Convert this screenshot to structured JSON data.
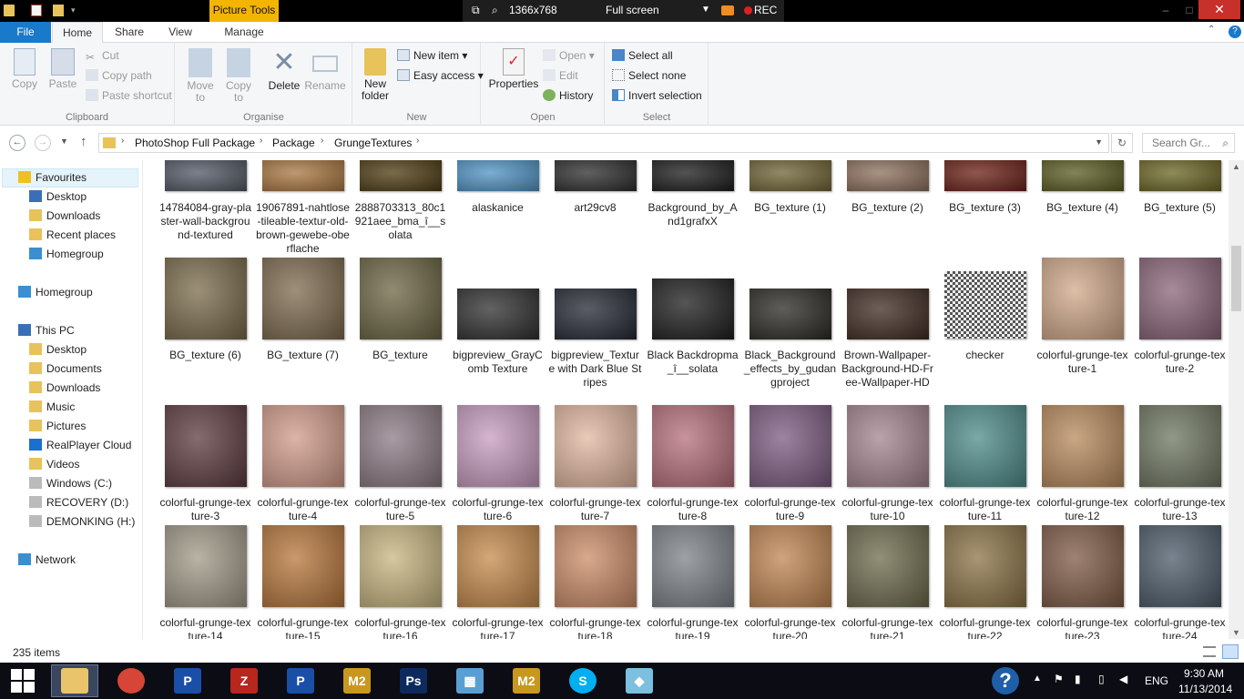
{
  "recorder": {
    "size_label": "1366x768",
    "mode_label": "Full screen",
    "rec_label": "REC"
  },
  "contextual_tab": "Picture Tools",
  "tabs": {
    "file": "File",
    "home": "Home",
    "share": "Share",
    "view": "View",
    "manage": "Manage"
  },
  "ribbon": {
    "clipboard": {
      "copy": "Copy",
      "paste": "Paste",
      "cut": "Cut",
      "copy_path": "Copy path",
      "paste_shortcut": "Paste shortcut",
      "label": "Clipboard"
    },
    "organise": {
      "move_to": "Move to",
      "copy_to": "Copy to",
      "delete": "Delete",
      "rename": "Rename",
      "label": "Organise"
    },
    "new": {
      "new_folder": "New folder",
      "new_item": "New item",
      "easy_access": "Easy access",
      "label": "New"
    },
    "open": {
      "properties": "Properties",
      "open": "Open",
      "edit": "Edit",
      "history": "History",
      "label": "Open"
    },
    "select": {
      "select_all": "Select all",
      "select_none": "Select none",
      "invert_selection": "Invert selection",
      "label": "Select"
    }
  },
  "breadcrumb": [
    "PhotoShop Full Package",
    "Package",
    "GrungeTextures"
  ],
  "search": {
    "placeholder": "Search Gr..."
  },
  "nav": {
    "favourites": "Favourites",
    "fav_items": [
      "Desktop",
      "Downloads",
      "Recent places",
      "Homegroup"
    ],
    "homegroup": "Homegroup",
    "this_pc": "This PC",
    "pc_items": [
      "Desktop",
      "Documents",
      "Downloads",
      "Music",
      "Pictures",
      "RealPlayer Cloud",
      "Videos",
      "Windows (C:)",
      "RECOVERY (D:)",
      "DEMONKING (H:)"
    ],
    "network": "Network"
  },
  "files": [
    {
      "name": "14784084-gray-plaster-wall-background-textured",
      "color": "#4f5663"
    },
    {
      "name": "19067891-nahtlose-tileable-textur-old-brown-gewebe-oberflache",
      "color": "#a9763f"
    },
    {
      "name": "2888703313_80c1921aee_bma_î__solata",
      "color": "#4c3a10"
    },
    {
      "name": "alaskanice",
      "color": "#4e93c4"
    },
    {
      "name": "art29cv8",
      "color": "#2b2b2b"
    },
    {
      "name": "Background_by_And1grafxX",
      "color": "#1a1a1a"
    },
    {
      "name": "BG_texture (1)",
      "color": "#6e6232"
    },
    {
      "name": "BG_texture (2)",
      "color": "#8c6f5c"
    },
    {
      "name": "BG_texture (3)",
      "color": "#6a1e14"
    },
    {
      "name": "BG_texture (4)",
      "color": "#5a5a20"
    },
    {
      "name": "BG_texture (5)",
      "color": "#6b6422"
    },
    {
      "name": "BG_texture (6)",
      "color": "#7a6b4a"
    },
    {
      "name": "BG_texture (7)",
      "color": "#7d6a4d"
    },
    {
      "name": "BG_texture",
      "color": "#6b6441"
    },
    {
      "name": "bigpreview_GrayComb Texture",
      "color": "#2e2e2e"
    },
    {
      "name": "bigpreview_Texture with Dark Blue Stripes",
      "color": "#232733"
    },
    {
      "name": "Black Backdropma_î__solata",
      "color": "#1c1c1c"
    },
    {
      "name": "Black_Background_effects_by_gudangproject",
      "color": "#2a2822"
    },
    {
      "name": "Brown-Wallpaper-Background-HD-Free-Wallpaper-HD",
      "color": "#3e2a20"
    },
    {
      "name": "checker",
      "color": "#9a9a9a"
    },
    {
      "name": "colorful-grunge-texture-1",
      "color": "#d2a98a"
    },
    {
      "name": "colorful-grunge-texture-2",
      "color": "#8a6478"
    },
    {
      "name": "colorful-grunge-texture-3",
      "color": "#5c3a3e"
    },
    {
      "name": "colorful-grunge-texture-4",
      "color": "#d29c8a"
    },
    {
      "name": "colorful-grunge-texture-5",
      "color": "#8c7a84"
    },
    {
      "name": "colorful-grunge-texture-6",
      "color": "#c79cc0"
    },
    {
      "name": "colorful-grunge-texture-7",
      "color": "#e2b7a0"
    },
    {
      "name": "colorful-grunge-texture-8",
      "color": "#b66e7a"
    },
    {
      "name": "colorful-grunge-texture-9",
      "color": "#7c5a80"
    },
    {
      "name": "colorful-grunge-texture-10",
      "color": "#a5848e"
    },
    {
      "name": "colorful-grunge-texture-11",
      "color": "#4d8c8a"
    },
    {
      "name": "colorful-grunge-texture-12",
      "color": "#b88a5c"
    },
    {
      "name": "colorful-grunge-texture-13",
      "color": "#6e7660"
    },
    {
      "name": "colorful-grunge-texture-14",
      "color": "#a29a88"
    },
    {
      "name": "colorful-grunge-texture-15",
      "color": "#b8763a"
    },
    {
      "name": "colorful-grunge-texture-16",
      "color": "#c8b680"
    },
    {
      "name": "colorful-grunge-texture-17",
      "color": "#c68a4a"
    },
    {
      "name": "colorful-grunge-texture-18",
      "color": "#cc8c66"
    },
    {
      "name": "colorful-grunge-texture-19",
      "color": "#7c8288"
    },
    {
      "name": "colorful-grunge-texture-20",
      "color": "#c08550"
    },
    {
      "name": "colorful-grunge-texture-21",
      "color": "#6c6a4a"
    },
    {
      "name": "colorful-grunge-texture-22",
      "color": "#8a7244"
    },
    {
      "name": "colorful-grunge-texture-23",
      "color": "#7e5a44"
    },
    {
      "name": "colorful-grunge-texture-24",
      "color": "#4a5a68"
    }
  ],
  "status": {
    "item_count": "235 items"
  },
  "taskbar": {
    "apps": [
      {
        "name": "file-explorer-icon",
        "color": "#e9c46a",
        "glyph": "",
        "active": true
      },
      {
        "name": "chrome-icon",
        "color": "#d64535",
        "glyph": "",
        "active": false
      },
      {
        "name": "app-p-icon",
        "color": "#1a4fa8",
        "glyph": "P",
        "active": false
      },
      {
        "name": "app-z-icon",
        "color": "#b8261e",
        "glyph": "Z",
        "active": false
      },
      {
        "name": "app-p2-icon",
        "color": "#1a4fa8",
        "glyph": "P",
        "active": false
      },
      {
        "name": "app-m2-icon",
        "color": "#c8981e",
        "glyph": "M2",
        "active": false
      },
      {
        "name": "photoshop-icon",
        "color": "#0d2a5e",
        "glyph": "Ps",
        "active": false
      },
      {
        "name": "calculator-icon",
        "color": "#5a9fd4",
        "glyph": "▦",
        "active": false
      },
      {
        "name": "app-m2b-icon",
        "color": "#c8981e",
        "glyph": "M2",
        "active": false
      },
      {
        "name": "skype-icon",
        "color": "#00aff0",
        "glyph": "S",
        "active": false
      },
      {
        "name": "notes-icon",
        "color": "#7cc0e0",
        "glyph": "◆",
        "active": false
      }
    ],
    "language": "ENG",
    "time": "9:30 AM",
    "date": "11/13/2014"
  }
}
